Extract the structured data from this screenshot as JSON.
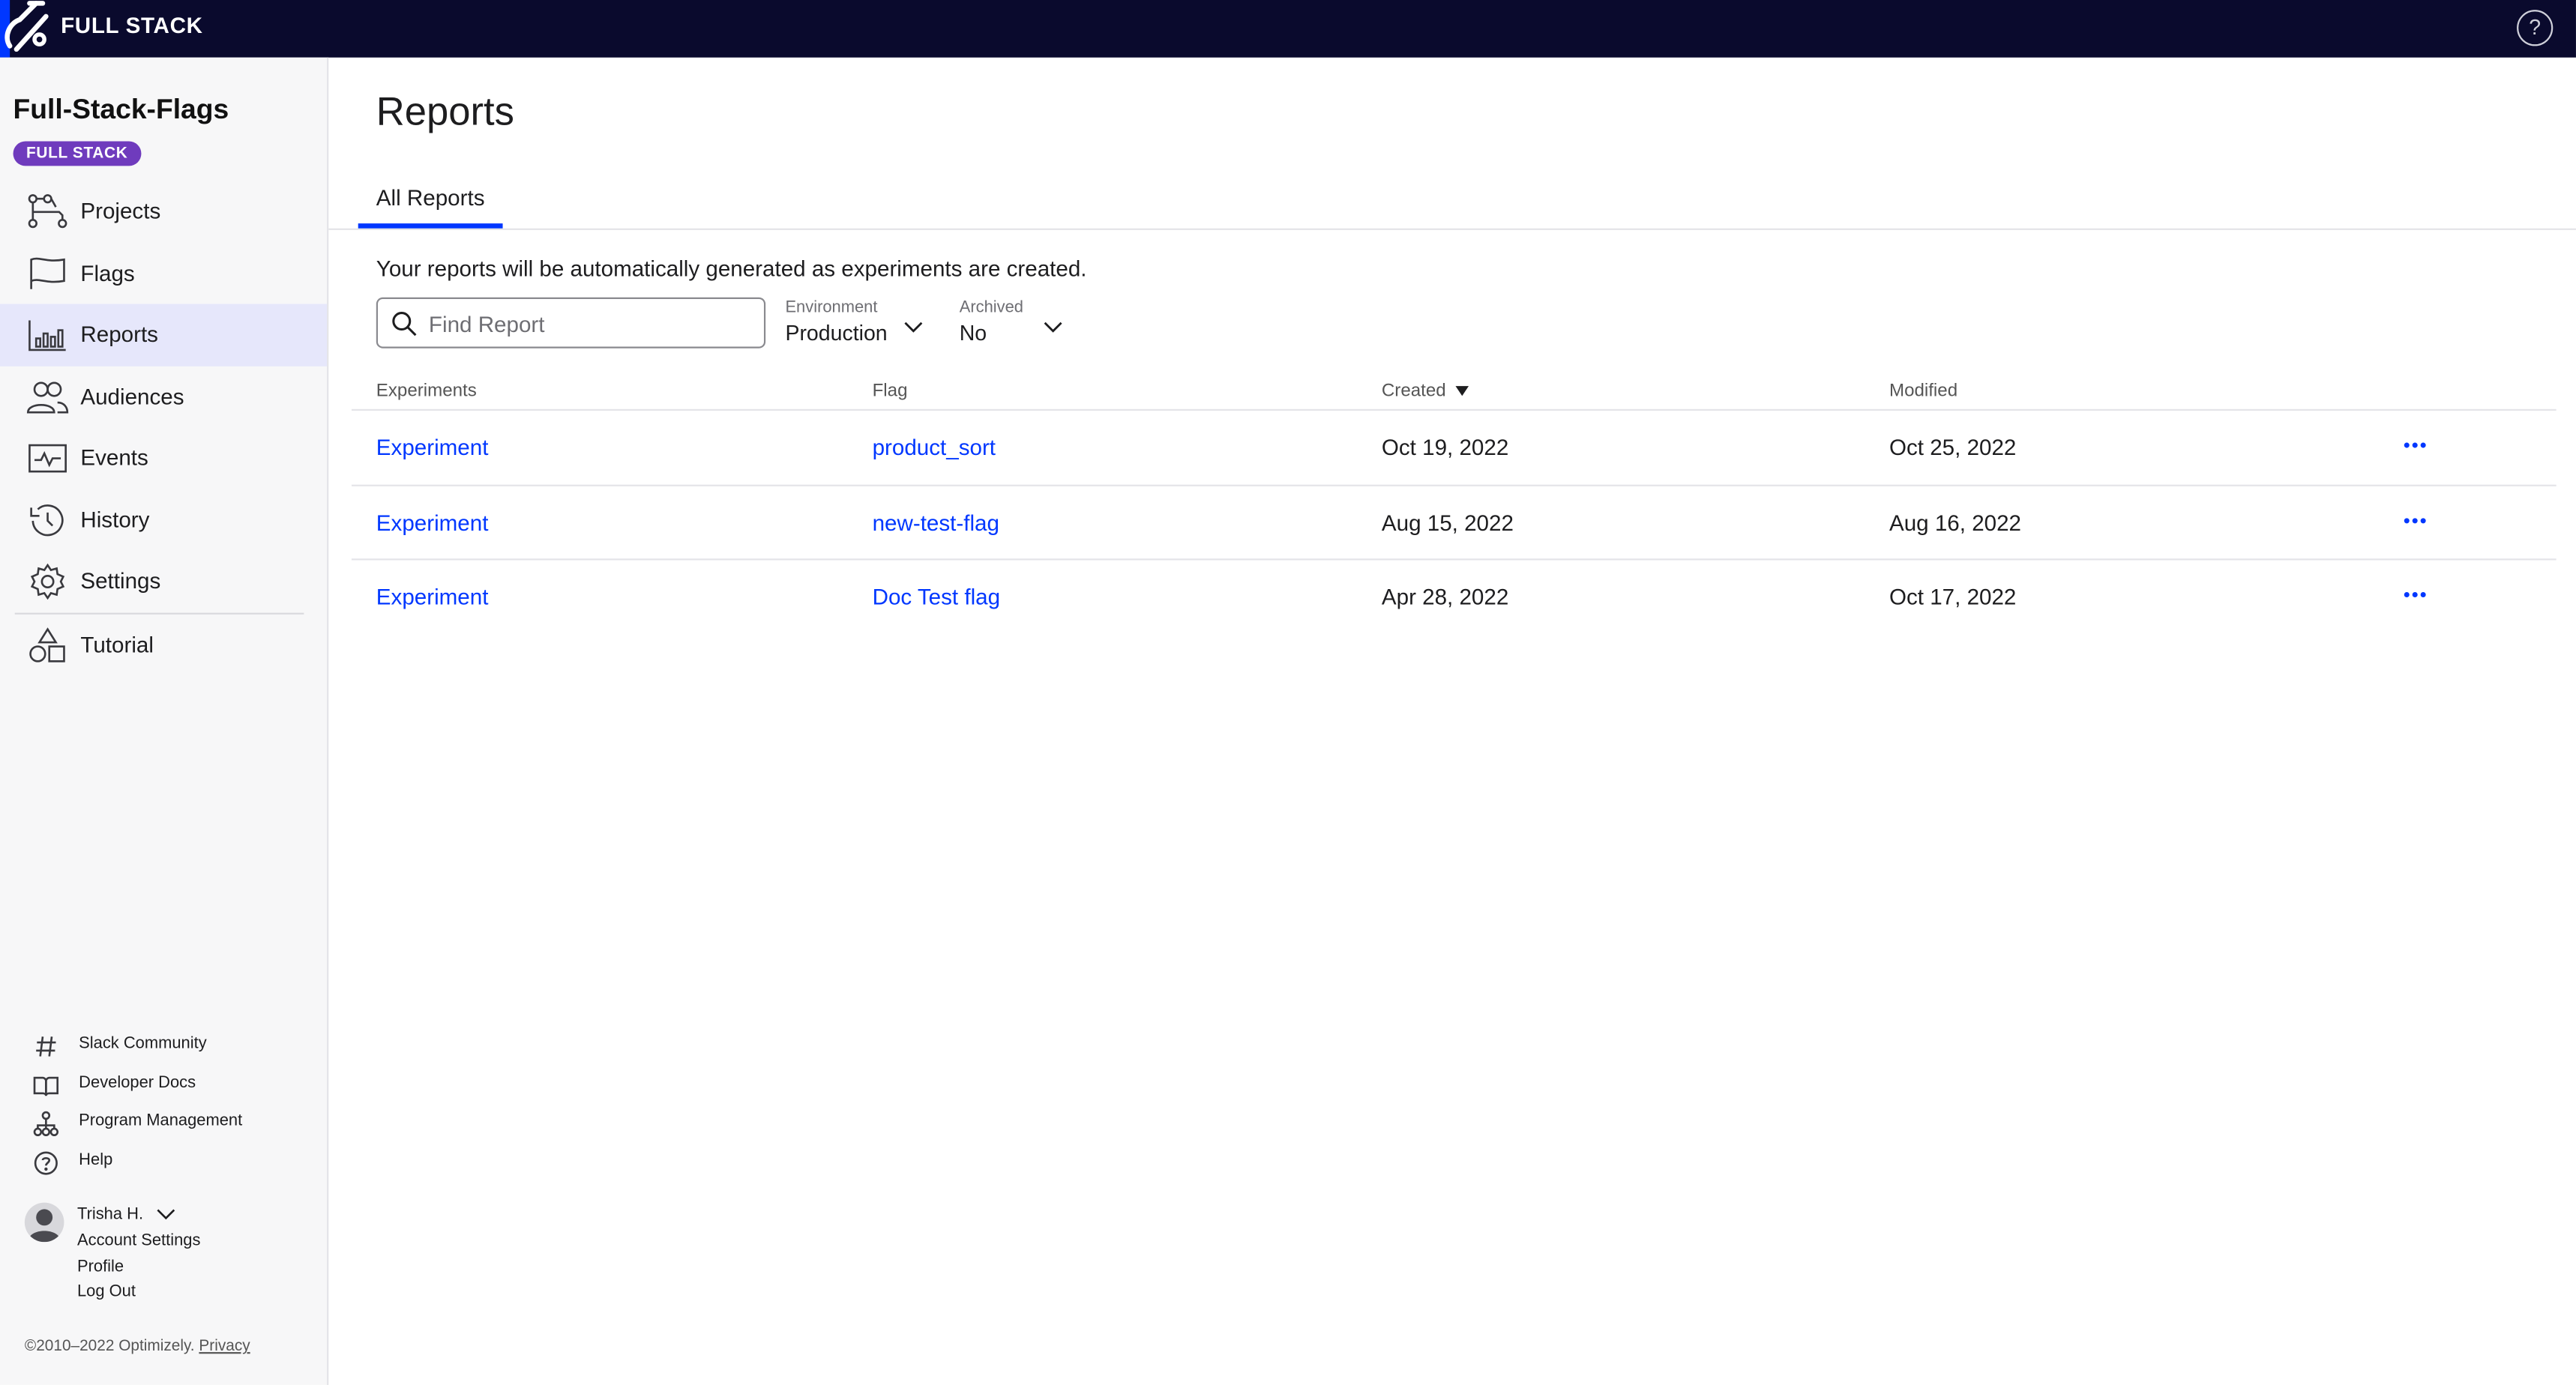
{
  "topbar": {
    "brand": "FULL STACK",
    "help_icon": "question-circle-icon"
  },
  "sidebar": {
    "project_title": "Full-Stack-Flags",
    "project_badge": "FULL STACK",
    "nav": [
      {
        "label": "Projects",
        "icon": "projects-icon"
      },
      {
        "label": "Flags",
        "icon": "flag-icon"
      },
      {
        "label": "Reports",
        "icon": "bar-chart-icon",
        "active": true
      },
      {
        "label": "Audiences",
        "icon": "audiences-icon"
      },
      {
        "label": "Events",
        "icon": "events-icon"
      },
      {
        "label": "History",
        "icon": "history-icon"
      },
      {
        "label": "Settings",
        "icon": "gear-icon"
      },
      {
        "label": "Tutorial",
        "icon": "tutorial-shapes-icon"
      }
    ],
    "footer_links": [
      {
        "label": "Slack Community",
        "icon": "hash-icon"
      },
      {
        "label": "Developer Docs",
        "icon": "book-icon"
      },
      {
        "label": "Program Management",
        "icon": "org-chart-icon"
      },
      {
        "label": "Help",
        "icon": "question-circle-icon"
      }
    ],
    "user": {
      "name": "Trisha H.",
      "links": [
        "Account Settings",
        "Profile",
        "Log Out"
      ]
    },
    "copyright": "©2010–2022 Optimizely.",
    "privacy": "Privacy"
  },
  "main": {
    "title": "Reports",
    "tabs": [
      {
        "label": "All Reports",
        "active": true
      }
    ],
    "description": "Your reports will be automatically generated as experiments are created.",
    "search": {
      "placeholder": "Find Report",
      "value": ""
    },
    "filters": {
      "environment": {
        "label": "Environment",
        "value": "Production"
      },
      "archived": {
        "label": "Archived",
        "value": "No"
      }
    },
    "table": {
      "columns": [
        "Experiments",
        "Flag",
        "Created",
        "Modified"
      ],
      "sorted_column": "Created",
      "sort_direction": "descending",
      "rows": [
        {
          "experiment": "Experiment",
          "flag": "product_sort",
          "created": "Oct 19, 2022",
          "modified": "Oct 25, 2022"
        },
        {
          "experiment": "Experiment",
          "flag": "new-test-flag",
          "created": "Aug 15, 2022",
          "modified": "Aug 16, 2022"
        },
        {
          "experiment": "Experiment",
          "flag": "Doc Test flag",
          "created": "Apr 28, 2022",
          "modified": "Oct 17, 2022"
        }
      ]
    }
  },
  "colors": {
    "topbar_bg": "#0a0a2d",
    "accent": "#0037ff",
    "badge": "#6f3bbd",
    "active_nav_bg": "#e6e7fb"
  }
}
